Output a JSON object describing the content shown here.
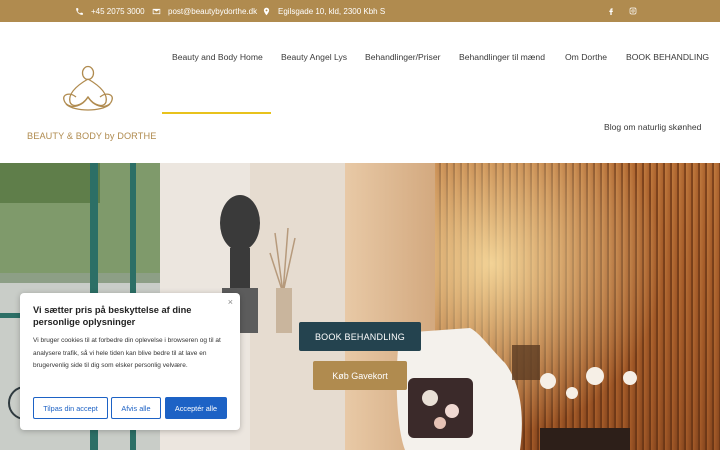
{
  "topbar": {
    "phone": "+45 2075 3000",
    "email": "post@beautybydorthe.dk",
    "address": "Egilsgade 10, kld, 2300 Kbh S",
    "social": [
      "facebook-icon",
      "instagram-icon"
    ]
  },
  "brand": {
    "name": "BEAUTY & BODY by DORTHE",
    "accent": "#b08b4f"
  },
  "nav": {
    "items": [
      {
        "label": "Beauty and Body Home"
      },
      {
        "label": "Beauty Angel Lys"
      },
      {
        "label": "Behandlinger/Priser"
      },
      {
        "label": "Behandlinger til mænd"
      },
      {
        "label": "Om Dorthe"
      },
      {
        "label": "BOOK BEHANDLING"
      },
      {
        "label": "Blog om naturlig skønhed"
      }
    ],
    "active_index": 0,
    "active_color": "#e8c21c"
  },
  "hero": {
    "book_label": "BOOK BEHANDLING",
    "gift_label": "Køb Gavekort"
  },
  "cookie": {
    "title": "Vi sætter pris på beskyttelse af dine personlige oplysninger",
    "text": "Vi bruger cookies til at forbedre din oplevelse i browseren og til at analysere trafik, så vi hele tiden kan blive bedre til at lave en brugervenlig side til dig som elsker personlig velvære.",
    "customize_label": "Tilpas din accept",
    "reject_label": "Afvis alle",
    "accept_label": "Acceptér alle",
    "close_label": "×",
    "button_color": "#1d62c5"
  }
}
